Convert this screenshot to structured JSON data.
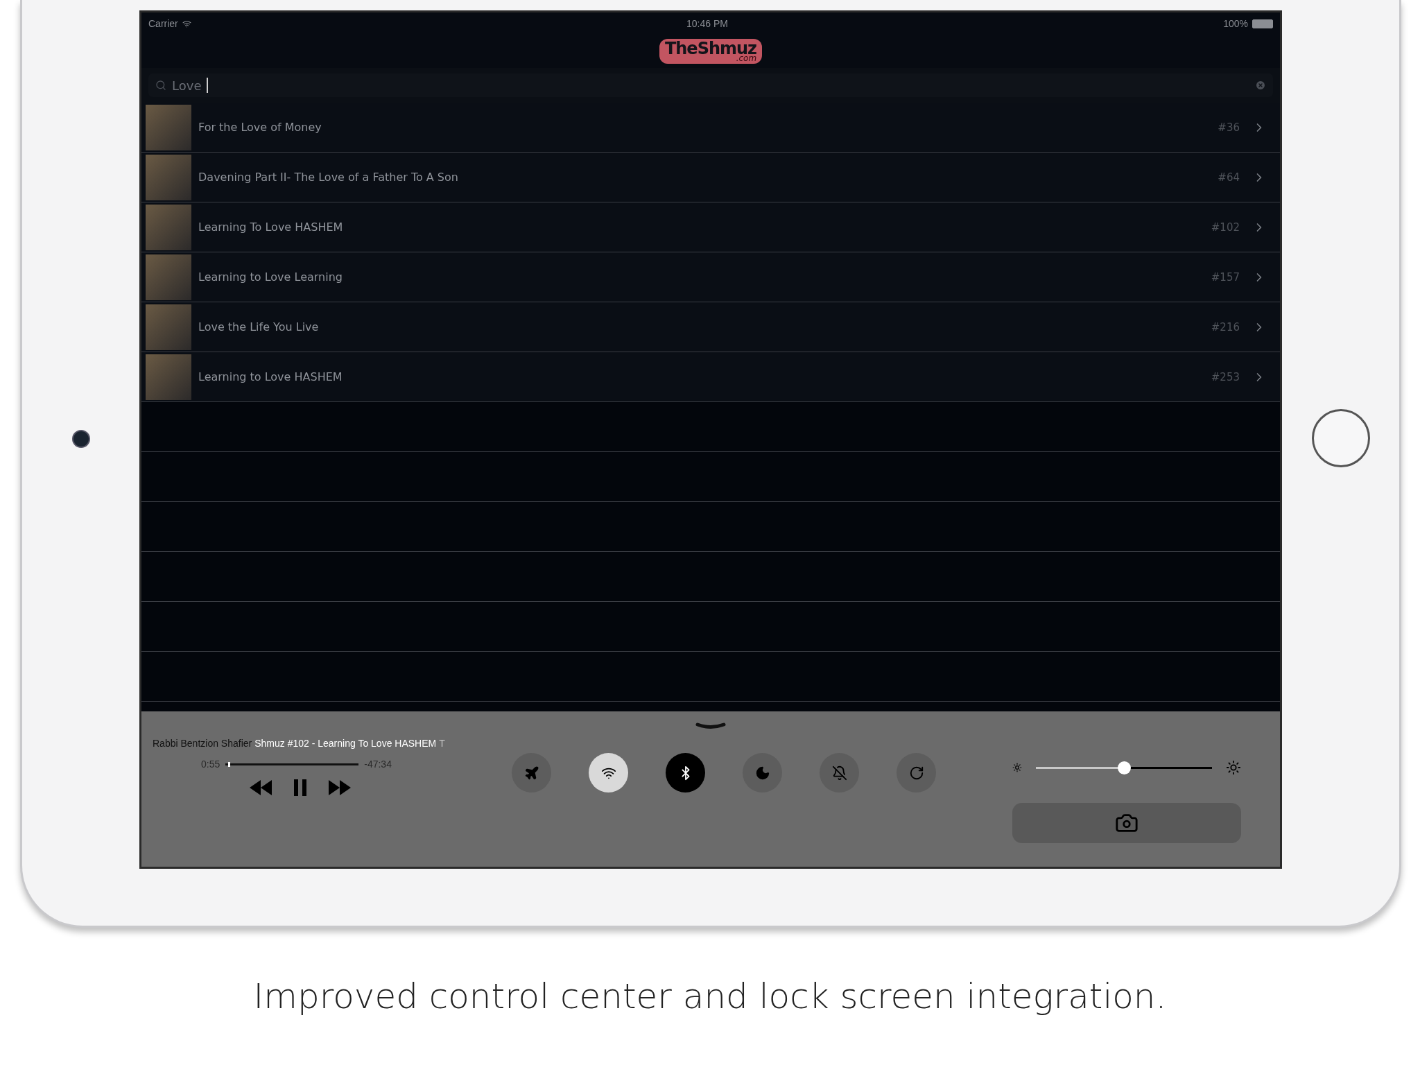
{
  "status_bar": {
    "carrier": "Carrier",
    "time": "10:46 PM",
    "battery": "100%"
  },
  "logo": {
    "main": "TheShmuz",
    "sub": ".com"
  },
  "search": {
    "value": "Love"
  },
  "results": [
    {
      "title": "For the Love of Money",
      "number": "#36"
    },
    {
      "title": "Davening Part II- The Love of a Father To A Son",
      "number": "#64"
    },
    {
      "title": "Learning To Love HASHEM",
      "number": "#102"
    },
    {
      "title": "Learning to Love Learning",
      "number": "#157"
    },
    {
      "title": "Love the Life You Live",
      "number": "#216"
    },
    {
      "title": "Learning to Love HASHEM",
      "number": "#253"
    }
  ],
  "control_center": {
    "now_playing": {
      "artist": "Rabbi Bentzion Shafier",
      "title": "Shmuz #102 - Learning To Love HASHEM",
      "title_overflow": "T",
      "elapsed": "0:55",
      "remaining": "-47:34",
      "level": 0.02
    },
    "toggles": [
      {
        "kind": "airplane",
        "on": false,
        "pressed": false
      },
      {
        "kind": "wifi",
        "on": true,
        "pressed": false
      },
      {
        "kind": "bluetooth",
        "on": false,
        "pressed": true
      },
      {
        "kind": "moon",
        "on": false,
        "pressed": false
      },
      {
        "kind": "mute",
        "on": false,
        "pressed": false
      },
      {
        "kind": "rotation",
        "on": false,
        "pressed": false
      }
    ],
    "brightness": {
      "level": 0.5
    }
  },
  "caption": "Improved control center and lock screen integration."
}
